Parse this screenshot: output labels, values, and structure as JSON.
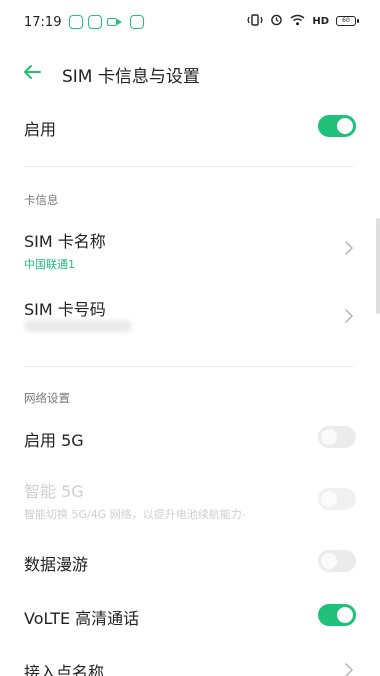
{
  "status_bar": {
    "time": "17:19",
    "hd": "HD",
    "battery": "60",
    "icons": [
      "app-notification-icon",
      "app-notification-icon",
      "video-icon",
      "app-notification-icon",
      "vibrate-icon",
      "alarm-icon",
      "wifi-icon",
      "battery-icon"
    ]
  },
  "header": {
    "title": "SIM 卡信息与设置",
    "back_icon": "back-arrow-icon"
  },
  "enable": {
    "label": "启用",
    "on": true
  },
  "card_info": {
    "section_title": "卡信息",
    "sim_name": {
      "label": "SIM 卡名称",
      "value": "中国联通1"
    },
    "sim_number": {
      "label": "SIM 卡号码"
    }
  },
  "network": {
    "section_title": "网络设置",
    "enable_5g": {
      "label": "启用 5G",
      "on": false
    },
    "smart_5g": {
      "label": "智能 5G",
      "desc": "智能切换 5G/4G 网络，以提升电池续航能力-",
      "on": false,
      "disabled": true
    },
    "roaming": {
      "label": "数据漫游",
      "on": false
    },
    "volte": {
      "label": "VoLTE 高清通话",
      "on": true
    },
    "apn": {
      "label": "接入点名称"
    }
  },
  "colors": {
    "accent": "#1fc179",
    "text": "#222222",
    "secondary": "#7a7a7a",
    "disabled": "#cfcfcf"
  }
}
